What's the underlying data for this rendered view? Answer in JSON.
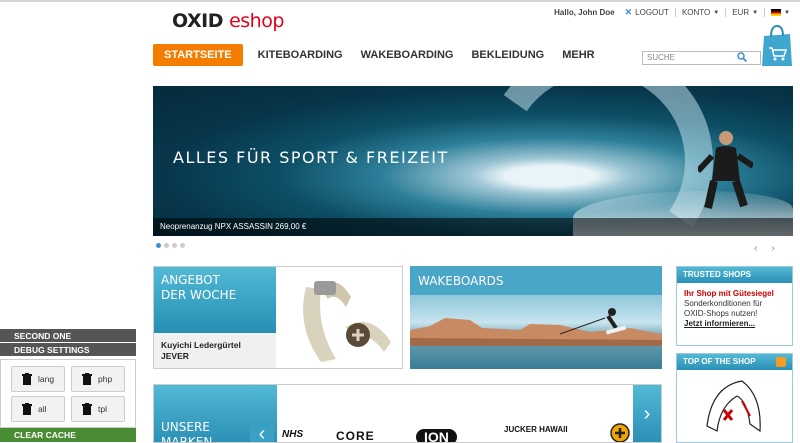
{
  "logo": {
    "part1": "OXID",
    "part2": "eshop"
  },
  "service": {
    "greeting": "Hallo, John Doe",
    "logout": "LOGOUT",
    "account": "KONTO",
    "currency": "EUR"
  },
  "nav": {
    "items": [
      "STARTSEITE",
      "KITEBOARDING",
      "WAKEBOARDING",
      "BEKLEIDUNG",
      "MEHR"
    ]
  },
  "search": {
    "placeholder": "SUCHE"
  },
  "banner": {
    "headline": "ALLES FÜR SPORT & FREIZEIT",
    "caption": "Neoprenanzug NPX ASSASSIN 269,00 €",
    "dots": 4,
    "active_dot": 1
  },
  "offer": {
    "title_line1": "ANGEBOT",
    "title_line2": "DER WOCHE",
    "product_line1": "Kuyichi Ledergürtel",
    "product_line2": "JEVER"
  },
  "wakeboards": {
    "title": "WAKEBOARDS"
  },
  "trusted": {
    "header": "TRUSTED SHOPS",
    "red": "Ihr Shop mit Gütesiegel",
    "text_line1": "Sonderkonditionen für",
    "text_line2": "OXID-Shops nutzen!",
    "link": "Jetzt informieren..."
  },
  "topshop": {
    "header": "TOP OF THE SHOP"
  },
  "brands": {
    "title_line1": "UNSERE",
    "title_line2": "MARKEN",
    "items": [
      "NHS",
      "CORE",
      "ION",
      "JUCKER HAWAII"
    ]
  },
  "debug": {
    "second_one": "SECOND ONE",
    "settings": "DEBUG SETTINGS",
    "buttons": [
      "lang",
      "php",
      "all",
      "tpl"
    ],
    "clear": "CLEAR CACHE"
  },
  "colors": {
    "accent": "#f47d00",
    "blue": "#2a8fb5",
    "green": "#4a8c33"
  }
}
